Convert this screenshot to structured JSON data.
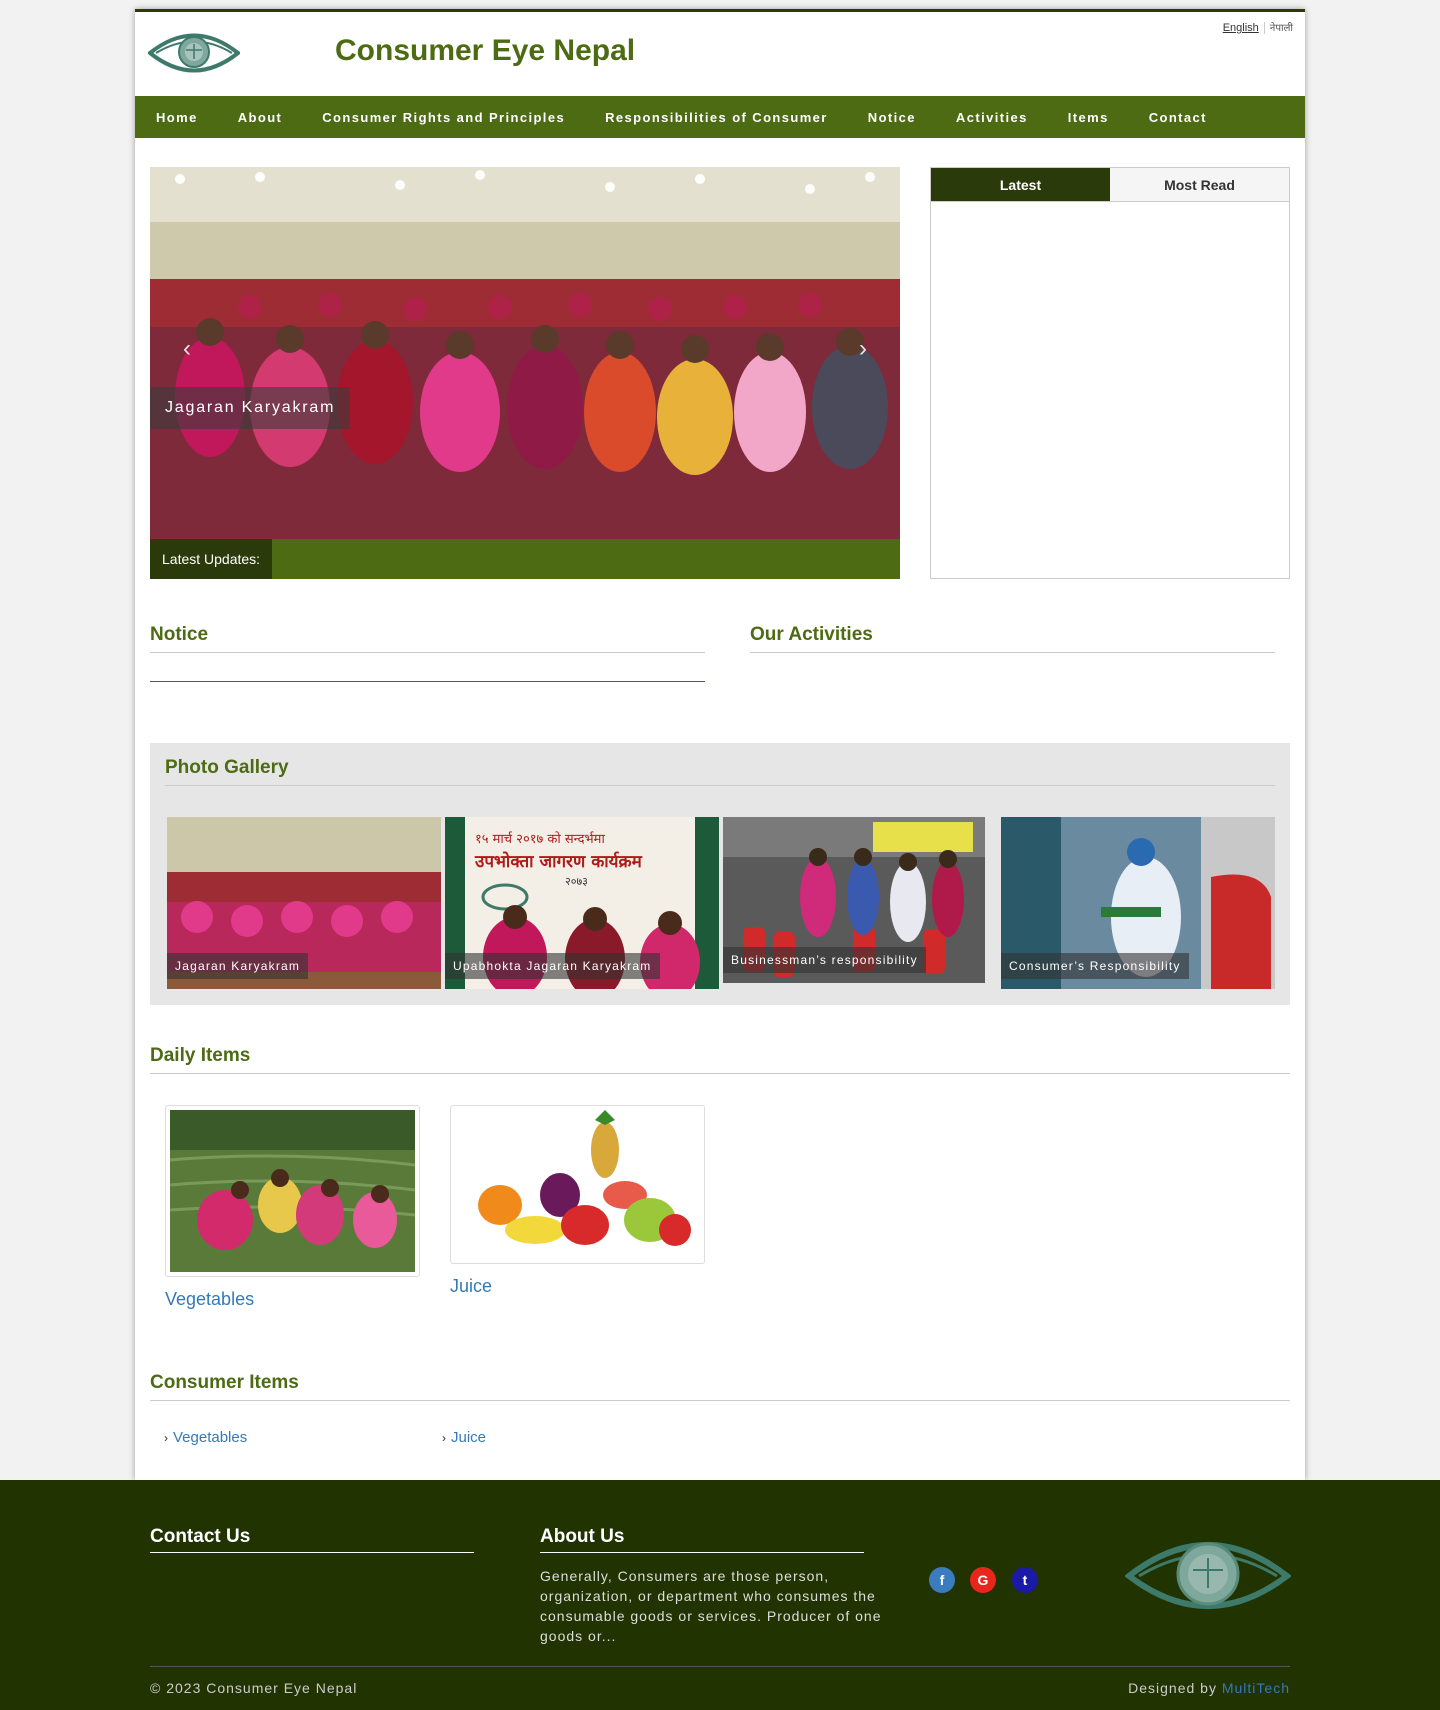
{
  "header": {
    "site_title": "Consumer Eye Nepal",
    "lang_english": "English",
    "lang_nepali": "नेपाली"
  },
  "nav": {
    "items": [
      "Home",
      "About",
      "Consumer Rights and Principles",
      "Responsibilities of Consumer",
      "Notice",
      "Activities",
      "Items",
      "Contact"
    ]
  },
  "slider": {
    "caption": "Jagaran Karyakram",
    "ticker_label": "Latest Updates:"
  },
  "tabs": {
    "latest": "Latest",
    "most_read": "Most Read"
  },
  "sections": {
    "notice": "Notice",
    "activities": "Our Activities",
    "gallery": "Photo Gallery",
    "daily_items": "Daily Items",
    "consumer_items": "Consumer Items"
  },
  "gallery": {
    "items": [
      "Jagaran Karyakram",
      "Upabhokta Jagaran Karyakram",
      "Businessman’s responsibility",
      "Consumer’s Responsibility"
    ],
    "banner_text_1": "१५ मार्च २०१७ को सन्दर्भमा",
    "banner_text_2": "उपभोक्ता जागरण कार्यक्रम",
    "banner_text_3": "२०७३"
  },
  "daily_items": [
    "Vegetables",
    "Juice"
  ],
  "consumer_items": [
    "Vegetables",
    "Juice"
  ],
  "footer": {
    "contact_title": "Contact Us",
    "about_title": "About Us",
    "about_text": "Generally, Consumers are those person, organization, or department who consumes the consumable goods or services. Producer of one goods or...",
    "copyright": "© 2023 Consumer Eye Nepal",
    "designed_prefix": "Designed by",
    "designed_by": "MultiTech",
    "social_facebook": "f",
    "social_google": "G",
    "social_twitter": "t"
  },
  "colors": {
    "brand_green": "#4d6b13",
    "dark_green": "#2b3a0a",
    "footer_bg": "#223302",
    "link_blue": "#337ab7",
    "facebook": "#3b7bbf",
    "google": "#e8261b",
    "twitter": "#1a1aa6"
  }
}
